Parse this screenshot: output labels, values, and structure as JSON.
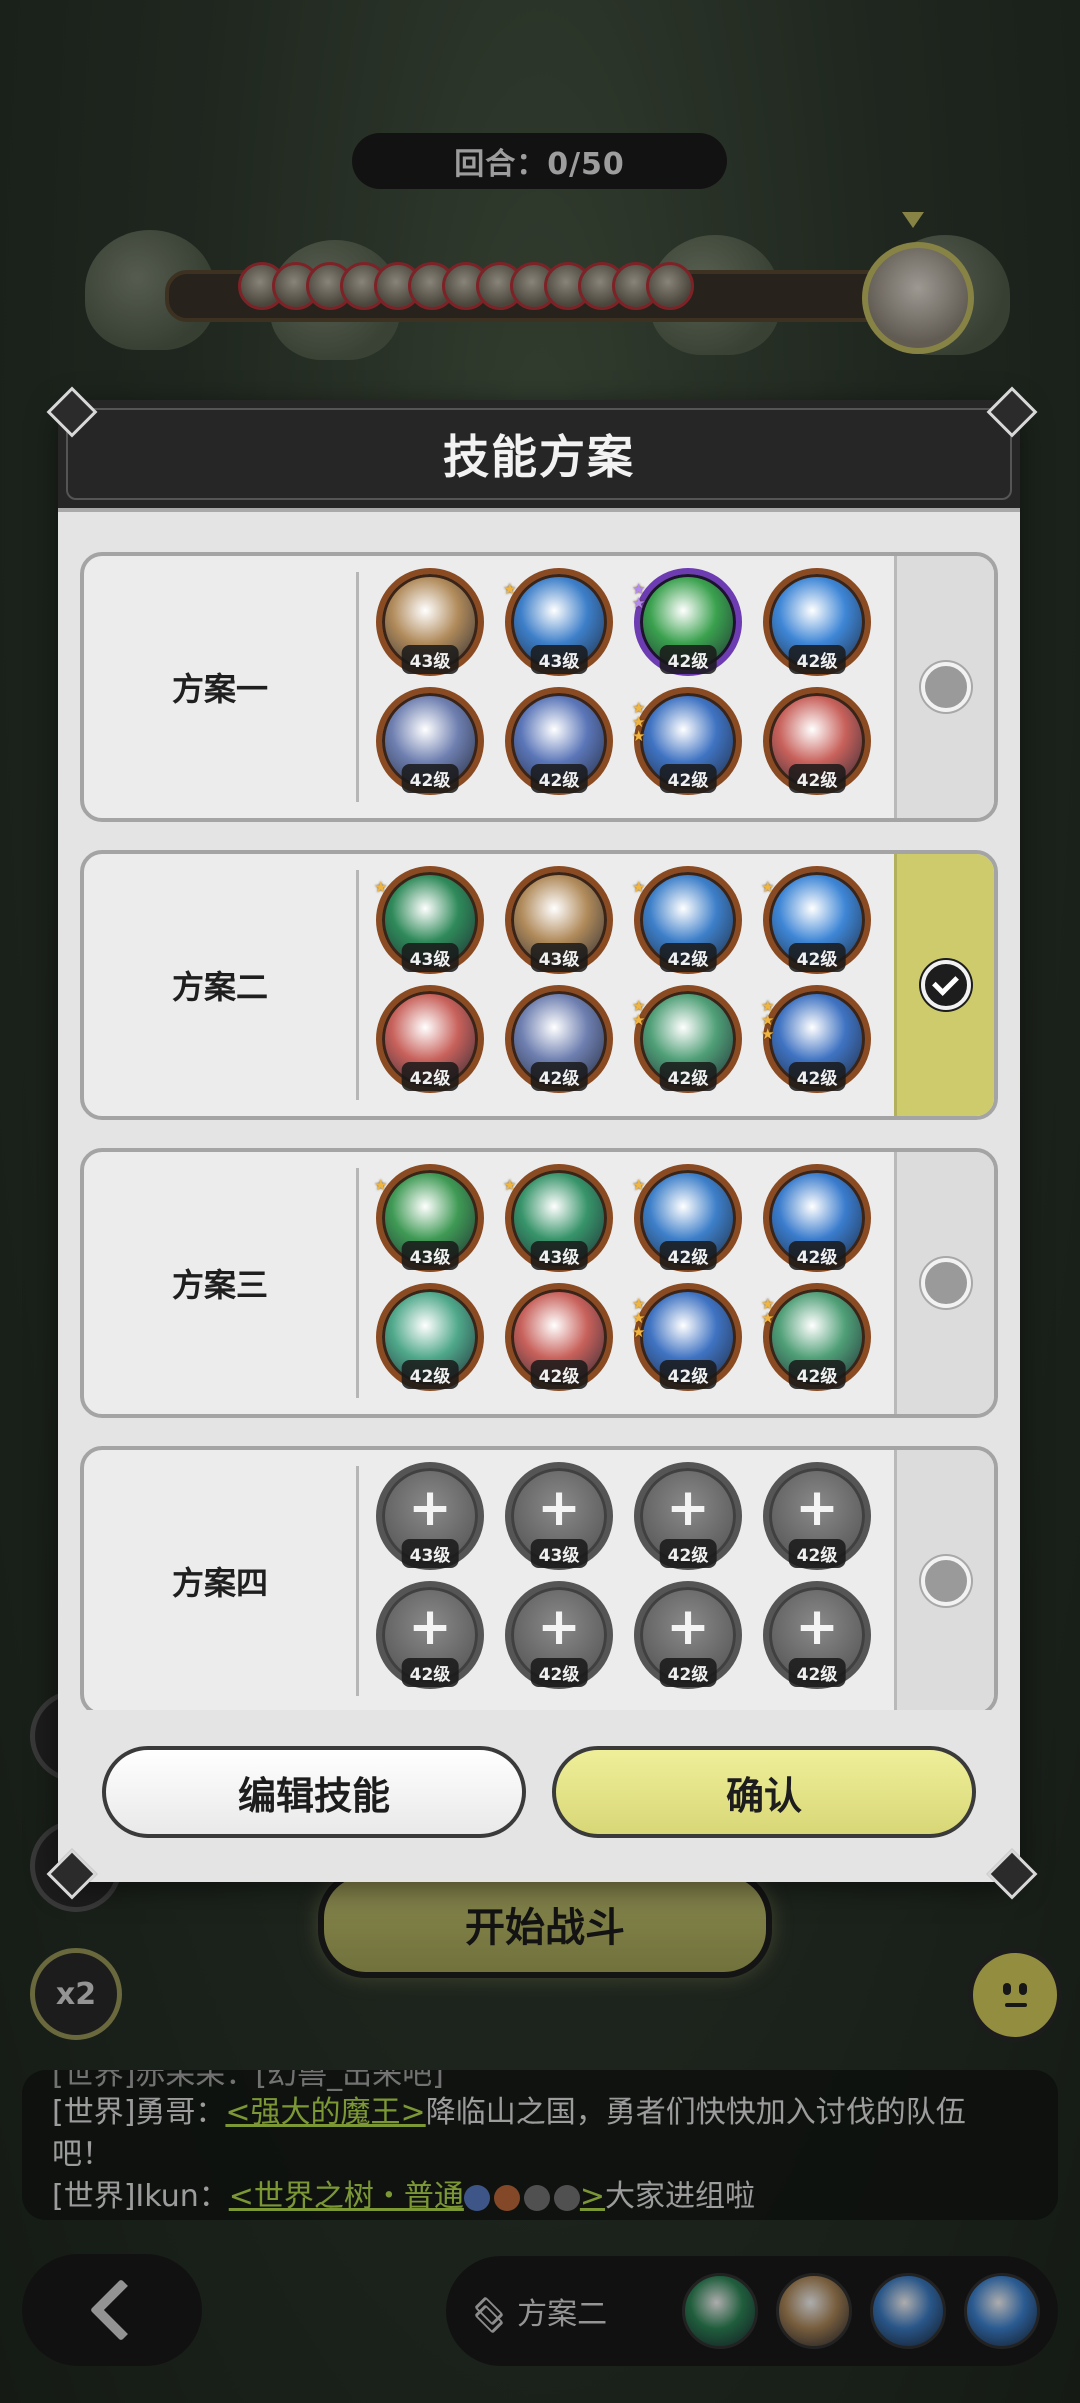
{
  "round": {
    "text": "回合：0/50"
  },
  "modal": {
    "title": "技能方案",
    "plans": [
      {
        "name": "方案一",
        "selected": false,
        "skills": [
          {
            "icon": "stone-shield-skill-icon",
            "level": "43级",
            "stars": 0,
            "color": "#b08a5a",
            "rarity": "normal"
          },
          {
            "icon": "ice-burst-skill-icon",
            "level": "43级",
            "stars": 1,
            "color": "#3d7fc9",
            "rarity": "normal"
          },
          {
            "icon": "heal-plus-skill-icon",
            "level": "42级",
            "stars": 2,
            "color": "#3aa14e",
            "rarity": "rare"
          },
          {
            "icon": "blue-flame-skill-icon",
            "level": "42级",
            "stars": 0,
            "color": "#3e86d6",
            "rarity": "normal"
          },
          {
            "icon": "spirit-orb-skill-icon",
            "level": "42级",
            "stars": 0,
            "color": "#6e7fb0",
            "rarity": "normal"
          },
          {
            "icon": "ice-crystal-skill-icon",
            "level": "42级",
            "stars": 0,
            "color": "#5b76b8",
            "rarity": "normal"
          },
          {
            "icon": "frost-claw-skill-icon",
            "level": "42级",
            "stars": 3,
            "color": "#3f73c2",
            "rarity": "normal"
          },
          {
            "icon": "fire-swirl-skill-icon",
            "level": "42级",
            "stars": 0,
            "color": "#c8615b",
            "rarity": "normal"
          }
        ]
      },
      {
        "name": "方案二",
        "selected": true,
        "skills": [
          {
            "icon": "thorn-vine-skill-icon",
            "level": "43级",
            "stars": 1,
            "color": "#2f8a5a",
            "rarity": "normal"
          },
          {
            "icon": "stone-shield-skill-icon",
            "level": "43级",
            "stars": 0,
            "color": "#b08a5a",
            "rarity": "normal"
          },
          {
            "icon": "ice-burst-skill-icon",
            "level": "42级",
            "stars": 1,
            "color": "#3d7fc9",
            "rarity": "normal"
          },
          {
            "icon": "blue-flame-skill-icon",
            "level": "42级",
            "stars": 1,
            "color": "#3e86d6",
            "rarity": "normal"
          },
          {
            "icon": "fire-swirl-skill-icon",
            "level": "42级",
            "stars": 0,
            "color": "#c8615b",
            "rarity": "normal"
          },
          {
            "icon": "spirit-orb-skill-icon",
            "level": "42级",
            "stars": 0,
            "color": "#6e7fb0",
            "rarity": "normal"
          },
          {
            "icon": "leaf-shield-skill-icon",
            "level": "42级",
            "stars": 2,
            "color": "#4f9f77",
            "rarity": "normal"
          },
          {
            "icon": "frost-claw-skill-icon",
            "level": "42级",
            "stars": 3,
            "color": "#3f73c2",
            "rarity": "normal"
          }
        ]
      },
      {
        "name": "方案三",
        "selected": false,
        "skills": [
          {
            "icon": "green-wind-skill-icon",
            "level": "43级",
            "stars": 1,
            "color": "#3f9a55",
            "rarity": "normal"
          },
          {
            "icon": "leaf-slash-skill-icon",
            "level": "43级",
            "stars": 1,
            "color": "#37946a",
            "rarity": "normal"
          },
          {
            "icon": "ice-burst-skill-icon",
            "level": "42级",
            "stars": 1,
            "color": "#3d7fc9",
            "rarity": "normal"
          },
          {
            "icon": "ice-shard-skill-icon",
            "level": "42级",
            "stars": 0,
            "color": "#3a7ccd",
            "rarity": "normal"
          },
          {
            "icon": "recycle-leaf-skill-icon",
            "level": "42级",
            "stars": 0,
            "color": "#4fa88a",
            "rarity": "normal"
          },
          {
            "icon": "fire-swirl-skill-icon",
            "level": "42级",
            "stars": 0,
            "color": "#c8615b",
            "rarity": "normal"
          },
          {
            "icon": "frost-claw-skill-icon",
            "level": "42级",
            "stars": 3,
            "color": "#3f73c2",
            "rarity": "normal"
          },
          {
            "icon": "leaf-shield-skill-icon",
            "level": "42级",
            "stars": 2,
            "color": "#4f9f77",
            "rarity": "normal"
          }
        ]
      },
      {
        "name": "方案四",
        "selected": false,
        "skills": [
          {
            "icon": "add-skill-icon",
            "level": "43级",
            "stars": 0,
            "empty": true
          },
          {
            "icon": "add-skill-icon",
            "level": "43级",
            "stars": 0,
            "empty": true
          },
          {
            "icon": "add-skill-icon",
            "level": "42级",
            "stars": 0,
            "empty": true
          },
          {
            "icon": "add-skill-icon",
            "level": "42级",
            "stars": 0,
            "empty": true
          },
          {
            "icon": "add-skill-icon",
            "level": "42级",
            "stars": 0,
            "empty": true
          },
          {
            "icon": "add-skill-icon",
            "level": "42级",
            "stars": 0,
            "empty": true
          },
          {
            "icon": "add-skill-icon",
            "level": "42级",
            "stars": 0,
            "empty": true
          },
          {
            "icon": "add-skill-icon",
            "level": "42级",
            "stars": 0,
            "empty": true
          }
        ]
      }
    ],
    "edit_label": "编辑技能",
    "confirm_label": "确认"
  },
  "battle": {
    "start_label": "开始战斗",
    "speed_label": "x2"
  },
  "chat": {
    "line0": "[世界]赤呆呆：[幻兽_出来吧]",
    "line1_prefix": "[世界]勇哥：",
    "line1_link": "<强大的魔王>",
    "line1_suffix": "降临山之国，勇者们快快加入讨伐的队伍",
    "line1_cont": "吧！",
    "line2_prefix": "[世界]Ikun：",
    "line2_link": "<世界之树・普通",
    "line2_link_end": ">",
    "line2_suffix": "大家进组啦"
  },
  "bottom": {
    "plan_label": "方案二",
    "skills": [
      {
        "icon": "thorn-vine-skill-icon",
        "color": "#2f8a5a"
      },
      {
        "icon": "stone-shield-skill-icon",
        "color": "#b08a5a"
      },
      {
        "icon": "ice-burst-skill-icon",
        "color": "#3d7fc9"
      },
      {
        "icon": "blue-flame-skill-icon",
        "color": "#3e86d6"
      }
    ]
  }
}
